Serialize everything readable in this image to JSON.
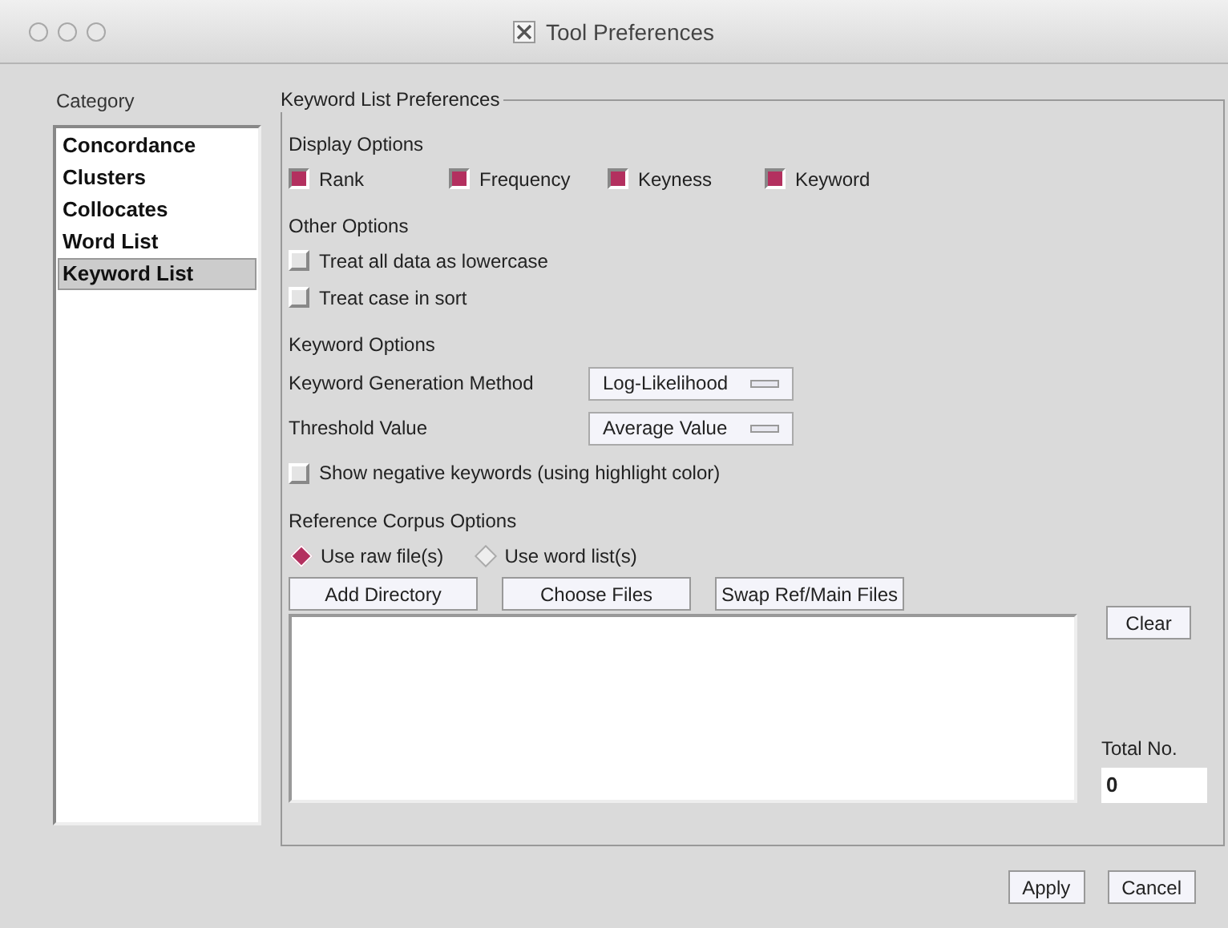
{
  "window": {
    "title": "Tool Preferences"
  },
  "category": {
    "label": "Category",
    "items": [
      {
        "label": "Concordance",
        "selected": false
      },
      {
        "label": "Clusters",
        "selected": false
      },
      {
        "label": "Collocates",
        "selected": false
      },
      {
        "label": "Word List",
        "selected": false
      },
      {
        "label": "Keyword List",
        "selected": true
      }
    ]
  },
  "panel": {
    "title": "Keyword List Preferences",
    "display_options": {
      "label": "Display Options",
      "items": [
        {
          "label": "Rank",
          "checked": true
        },
        {
          "label": "Frequency",
          "checked": true
        },
        {
          "label": "Keyness",
          "checked": true
        },
        {
          "label": "Keyword",
          "checked": true
        }
      ]
    },
    "other_options": {
      "label": "Other Options",
      "items": [
        {
          "label": "Treat all data as lowercase",
          "checked": false
        },
        {
          "label": "Treat case in sort",
          "checked": false
        }
      ]
    },
    "keyword_options": {
      "label": "Keyword Options",
      "fields": [
        {
          "label": "Keyword Generation Method",
          "value": "Log-Likelihood"
        },
        {
          "label": "Threshold Value",
          "value": "Average Value"
        }
      ],
      "show_negative": {
        "label": "Show negative keywords (using highlight color)",
        "checked": false
      }
    },
    "reference_corpus": {
      "label": "Reference Corpus Options",
      "radios": [
        {
          "label": "Use raw file(s)",
          "selected": true
        },
        {
          "label": "Use word list(s)",
          "selected": false
        }
      ],
      "buttons": [
        "Add Directory",
        "Choose Files",
        "Swap Ref/Main Files"
      ],
      "clear_button": "Clear",
      "total_label": "Total No.",
      "total_value": "0"
    }
  },
  "buttons": [
    "Apply",
    "Cancel"
  ]
}
